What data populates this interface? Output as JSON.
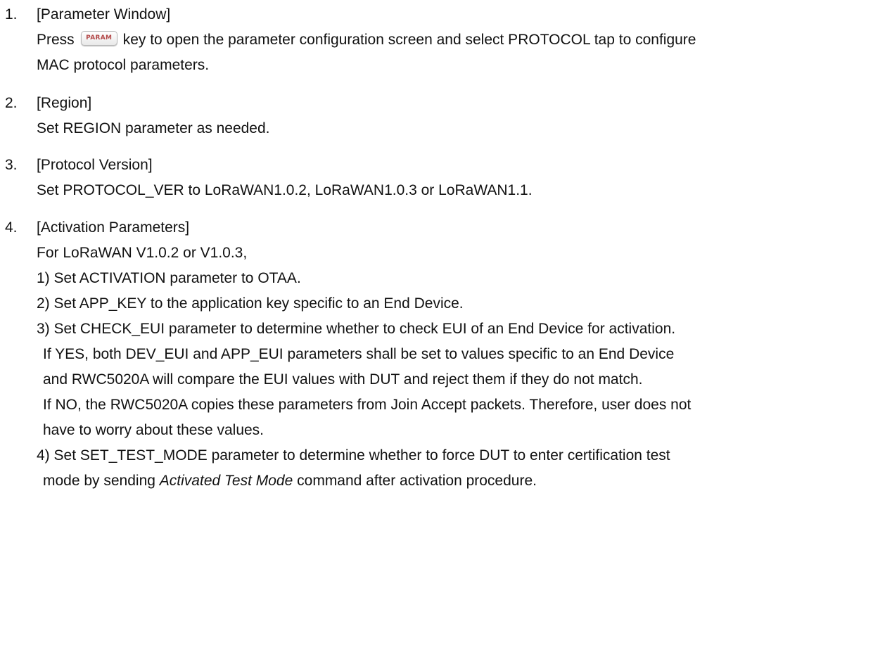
{
  "items": [
    {
      "number": "1.",
      "heading": "[Parameter Window]",
      "line1_before_key": "Press",
      "key_label": "PARAM",
      "line1_after_key": "key to open the parameter configuration screen and select PROTOCOL tap to configure",
      "line2": "MAC protocol parameters."
    },
    {
      "number": "2.",
      "heading": "[Region]",
      "line1": "Set REGION parameter as needed."
    },
    {
      "number": "3.",
      "heading": "[Protocol Version]",
      "line1": "Set PROTOCOL_VER to LoRaWAN1.0.2, LoRaWAN1.0.3 or LoRaWAN1.1."
    },
    {
      "number": "4.",
      "heading": "[Activation Parameters]",
      "intro": "For LoRaWAN V1.0.2 or V1.0.3,",
      "steps": [
        {
          "text": "1) Set ACTIVATION parameter to OTAA."
        },
        {
          "text": "2) Set APP_KEY to the application key specific to an End Device."
        },
        {
          "text": "3) Set CHECK_EUI parameter to determine whether to check EUI of an End Device for activation.",
          "cont": [
            "If YES, both DEV_EUI and APP_EUI parameters shall be set to values specific to an End Device",
            "and RWC5020A will compare the EUI values with DUT and reject them if they do not match.",
            "If NO, the RWC5020A copies these parameters from Join Accept packets. Therefore, user does not",
            "have to worry about these values."
          ]
        },
        {
          "text": "4) Set SET_TEST_MODE parameter to determine whether to force DUT to enter certification test",
          "cont_before": "mode by sending",
          "cont_em": "Activated Test Mode",
          "cont_after": "command after activation procedure."
        }
      ]
    }
  ]
}
